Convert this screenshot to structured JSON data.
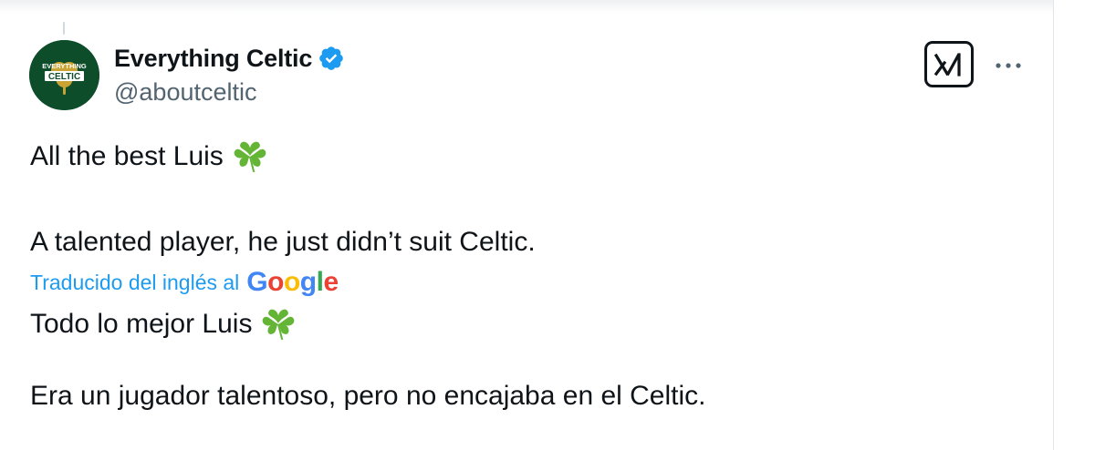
{
  "author": {
    "display_name": "Everything Celtic",
    "handle": "@aboutceltic",
    "avatar_text_top": "EVERYTHING",
    "avatar_text_main": "CELTIC",
    "verified": true,
    "verified_color": "#1d9bf0"
  },
  "toolbar": {
    "grok_icon": "grok-icon",
    "more_icon": "more-dots-icon"
  },
  "tweet": {
    "original": {
      "line1": "All the best Luis",
      "line2": "A talented player, he just didn’t suit Celtic."
    },
    "translation": {
      "label": "Traducido del inglés al",
      "provider": [
        "G",
        "o",
        "o",
        "g",
        "l",
        "e"
      ],
      "provider_colors": [
        "#4285f4",
        "#ea4335",
        "#fbbc05",
        "#4285f4",
        "#34a853",
        "#ea4335"
      ],
      "line1": "Todo lo mejor Luis",
      "line2": "Era un jugador talentoso, pero no encajaba en el Celtic."
    },
    "emoji": "shamrock-icon"
  },
  "colors": {
    "text": "#0f1419",
    "secondary": "#536471",
    "link": "#1d9bf0",
    "avatar_bg": "#0e4d2a",
    "clover": "#64b436"
  }
}
